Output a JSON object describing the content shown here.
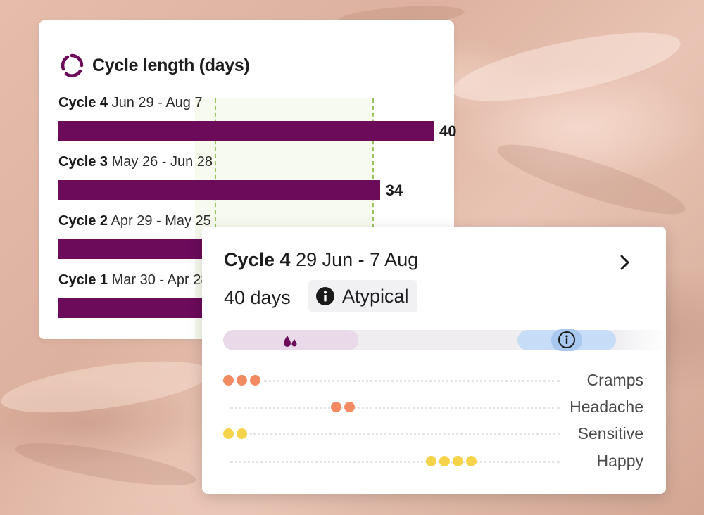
{
  "chart_data": {
    "type": "bar",
    "title": "Cycle length (days)",
    "categories": [
      "Cycle 4",
      "Cycle 3",
      "Cycle 2",
      "Cycle 1"
    ],
    "date_ranges": [
      "Jun 29 - Aug 7",
      "May 26 - Jun 28",
      "Apr 29 - May 25",
      "Mar 30 - Apr 28"
    ],
    "values": [
      40,
      34,
      27,
      30
    ],
    "value_labels_shown": [
      "40",
      "34",
      "",
      ""
    ],
    "normal_range_days": [
      21,
      35
    ],
    "grid": false,
    "bar_color": "#6b0b5a"
  },
  "detail": {
    "cycle": "Cycle 4",
    "dates": "29 Jun - 7 Aug",
    "days": "40 days",
    "badge": "Atypical",
    "symptoms": [
      {
        "label": "Cramps",
        "level": 3,
        "color": "orange"
      },
      {
        "label": "Headache",
        "level": 2,
        "color": "orange"
      },
      {
        "label": "Sensitive",
        "level": 2,
        "color": "yellow"
      },
      {
        "label": "Happy",
        "level": 4,
        "color": "yellow"
      }
    ]
  },
  "icons": {
    "title_icon": "cycle-ring-icon",
    "badge_icon": "info-icon",
    "period_icon": "drops-icon",
    "timeline_info_icon": "info-icon",
    "next_icon": "chevron-right-icon"
  },
  "colors": {
    "accent": "#6b0b5a",
    "normal_range": "#9bc45b",
    "symptom_orange": "#f28a62",
    "symptom_yellow": "#f5d34a",
    "info_blue": "#c7dcf6"
  }
}
